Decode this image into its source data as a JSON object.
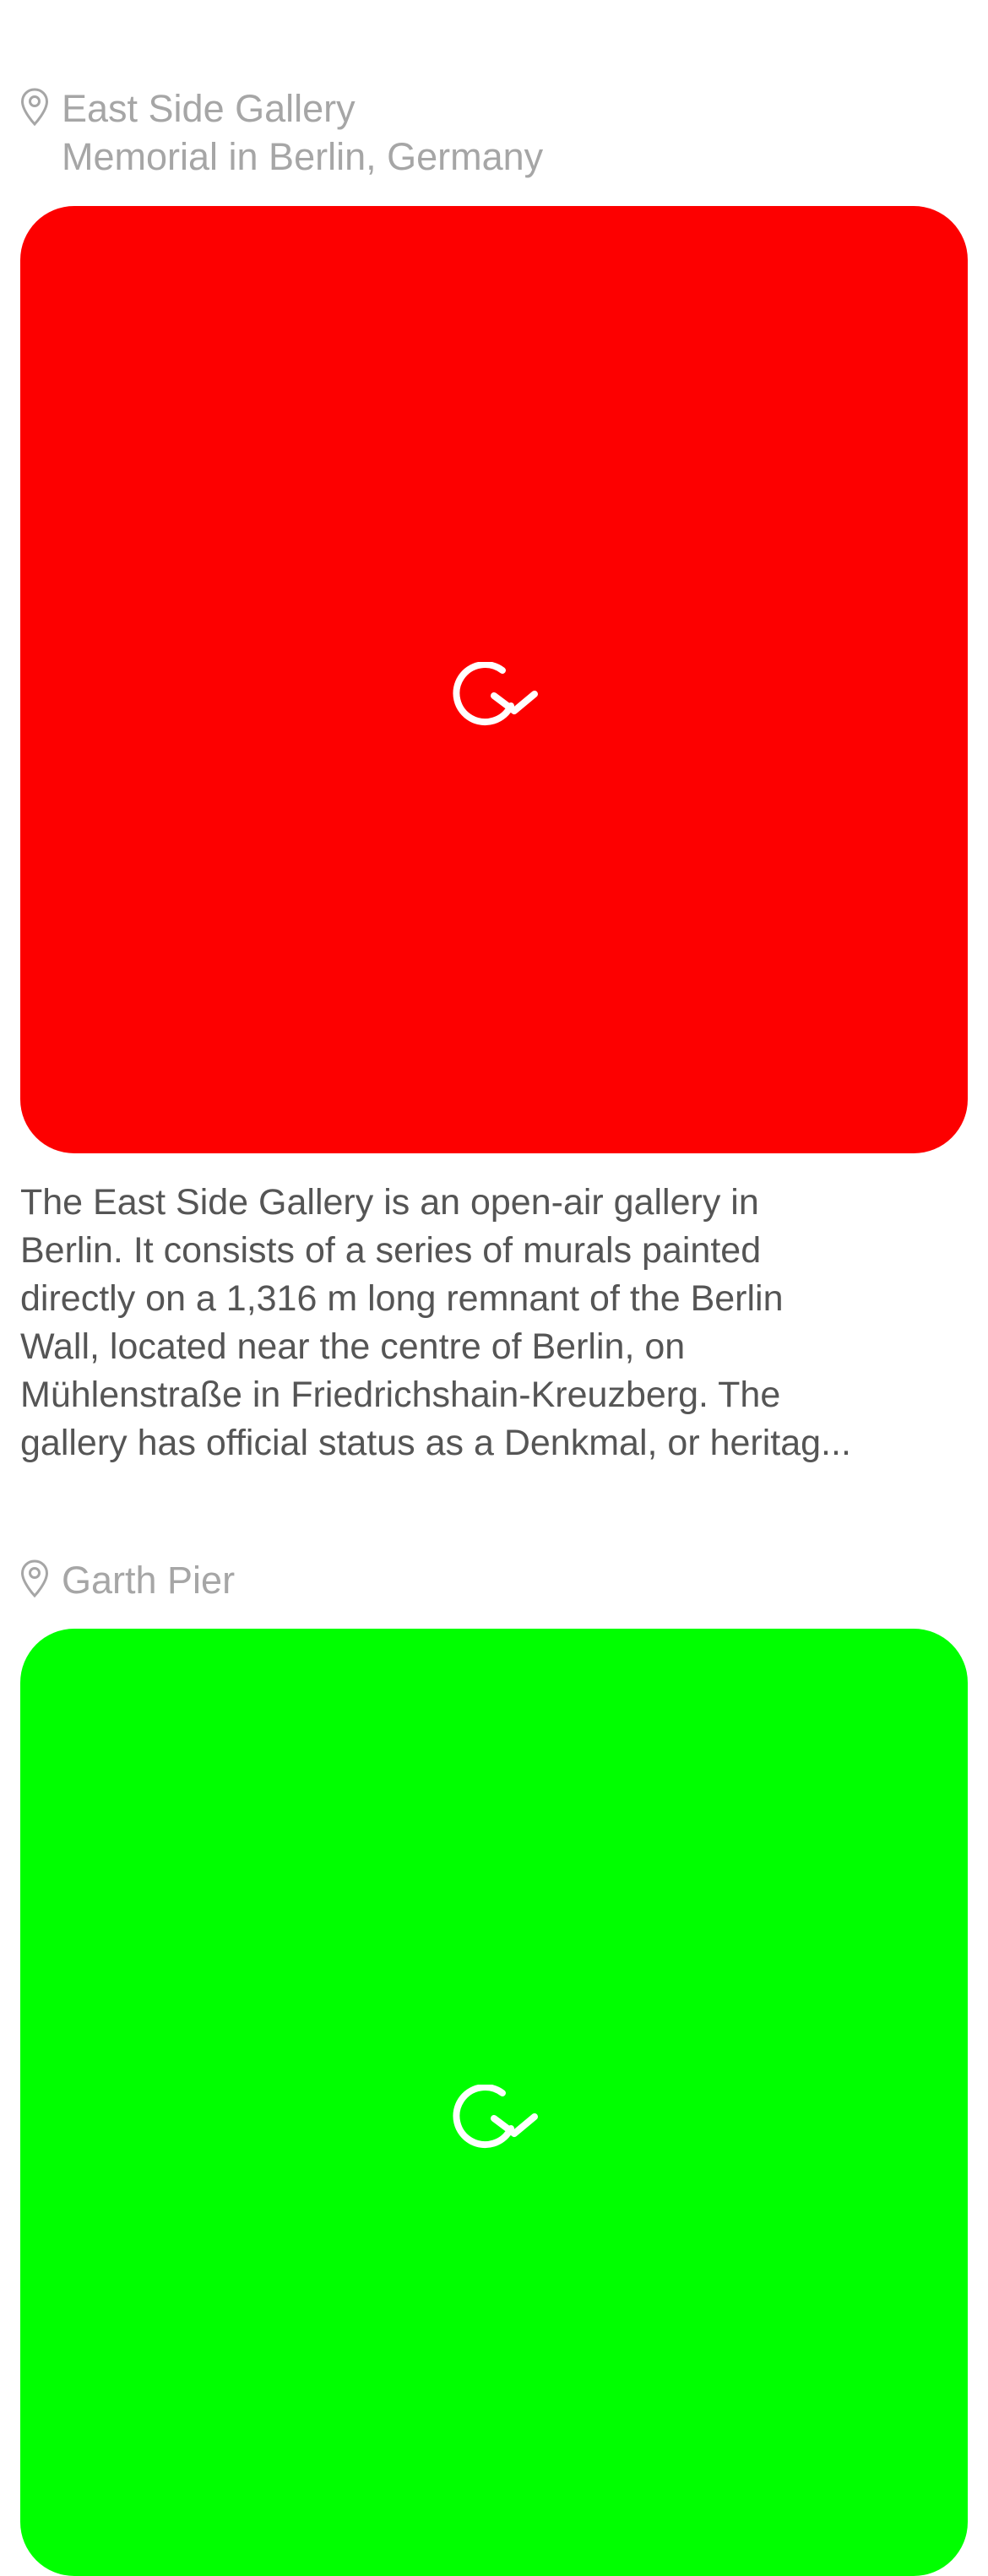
{
  "colors": {
    "card1_photo": "#fd0000",
    "card2_photo": "#00ff00",
    "location_text": "#a6a6a6",
    "description_text": "#555555"
  },
  "feed": {
    "items": [
      {
        "title": "East Side Gallery",
        "subtitle": "Memorial in Berlin, Germany",
        "photo_icon": "refresh-icon",
        "description_lines": [
          "The East Side Gallery is an open-air gallery in",
          "Berlin. It consists of a series of murals painted",
          "directly on a 1,316 m long remnant of the Berlin",
          "Wall, located near the centre of Berlin, on",
          "Mühlenstraße in Friedrichshain-Kreuzberg. The",
          "gallery has official status as a Denkmal, or heritag..."
        ]
      },
      {
        "title": "Garth Pier",
        "photo_icon": "refresh-icon"
      }
    ]
  }
}
